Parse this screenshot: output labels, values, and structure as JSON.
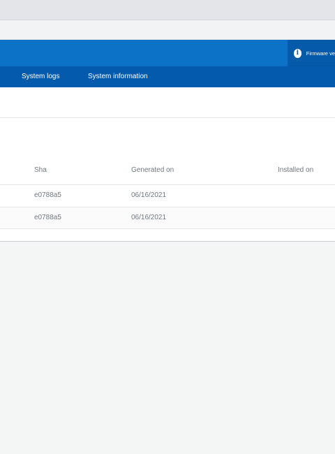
{
  "header": {
    "firmware_notice": "Firmware ve"
  },
  "nav": {
    "items": [
      {
        "label": "System logs"
      },
      {
        "label": "System information"
      }
    ]
  },
  "table": {
    "columns": [
      "Sha",
      "Generated on",
      "Installed on"
    ],
    "rows": [
      {
        "sha": "e0788a5",
        "generated_on": "06/16/2021",
        "installed_on": ""
      },
      {
        "sha": "e0788a5",
        "generated_on": "06/16/2021",
        "installed_on": ""
      }
    ]
  },
  "colors": {
    "header_blue": "#0b72c8",
    "nav_blue": "#045bad",
    "notice_blue": "#055aa9"
  }
}
